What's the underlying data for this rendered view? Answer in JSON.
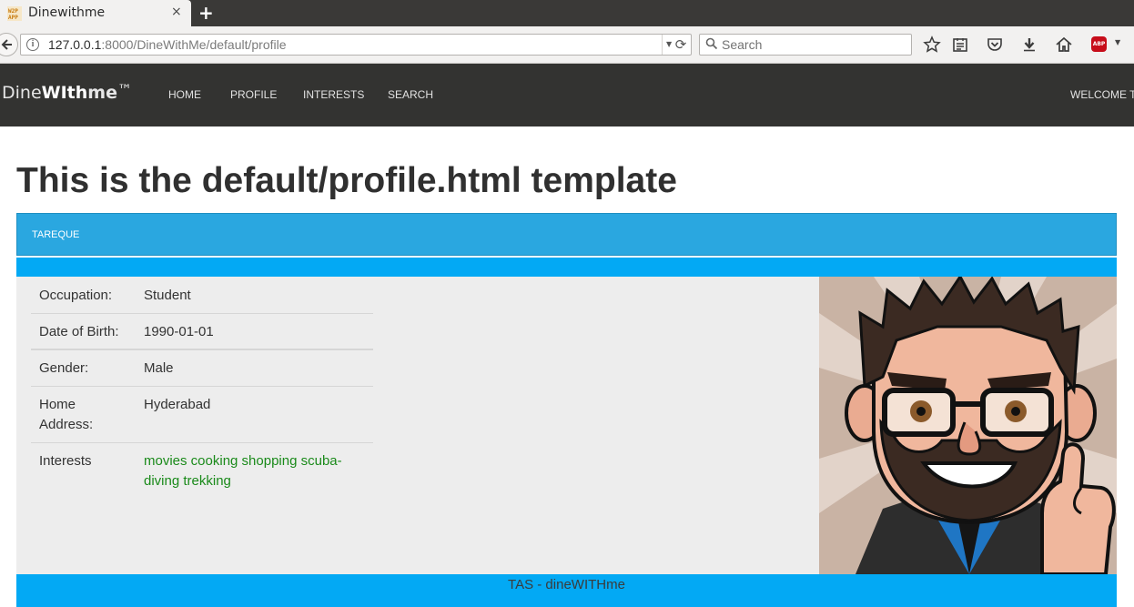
{
  "browser": {
    "tab_title": "Dinewithme",
    "favicon_text": "W2P APP",
    "tab_close": "×",
    "new_tab": "+",
    "url_host": "127.0.0.1",
    "url_rest": ":8000/DineWithMe/default/profile",
    "reload": "⟳",
    "search_placeholder": "Search",
    "abp_label": "ABP"
  },
  "site": {
    "brand_part1": "Dine",
    "brand_part2": "WIth",
    "brand_part3": "me",
    "brand_tm": "™",
    "nav": [
      {
        "label": "HOME"
      },
      {
        "label": "PROFILE"
      },
      {
        "label": "INTERESTS"
      },
      {
        "label": "SEARCH"
      }
    ],
    "welcome": "WELCOME T"
  },
  "page": {
    "title": "This is the default/profile.html template",
    "panel_name": "TAREQUE",
    "fields": {
      "occupation_label": "Occupation:",
      "occupation_value": "Student",
      "dob_label": "Date of Birth:",
      "dob_value": "1990-01-01",
      "gender_label": "Gender:",
      "gender_value": "Male",
      "address_label": "Home Address:",
      "address_value": "Hyderabad",
      "interests_label": "Interests",
      "interests_value": "movies cooking shopping scuba-diving trekking"
    },
    "footer": "TAS - dineWITHme"
  },
  "colors": {
    "header_bg": "#333331",
    "panel_heading": "#2aa7e0",
    "accent_blue": "#03a9f4",
    "body_bg": "#ededed",
    "interest_green": "#1a8a1a"
  }
}
